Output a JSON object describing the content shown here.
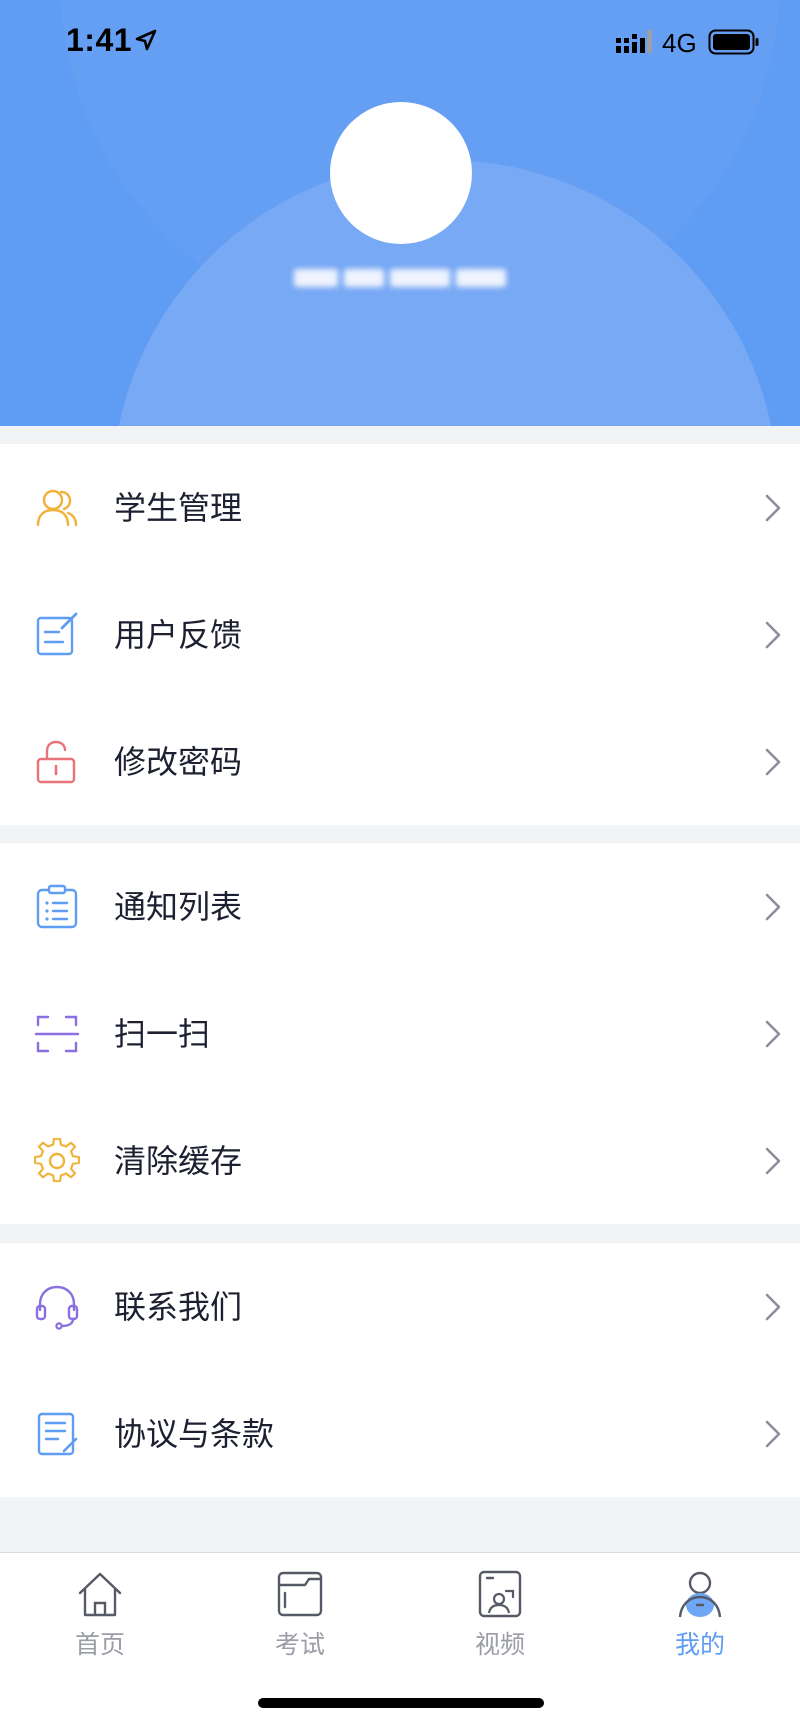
{
  "status_bar": {
    "time": "1:41",
    "network": "4G",
    "location_icon": "location-arrow-icon",
    "signal_icon": "signal-bars-icon",
    "battery_icon": "battery-icon"
  },
  "profile": {
    "avatar_icon": "avatar-circle",
    "username": ""
  },
  "menu_groups": [
    {
      "items": [
        {
          "label": "学生管理",
          "icon": "students-icon",
          "color": "#f0b23a"
        },
        {
          "label": "用户反馈",
          "icon": "feedback-edit-icon",
          "color": "#5f9cf3"
        },
        {
          "label": "修改密码",
          "icon": "unlock-icon",
          "color": "#e8737a"
        }
      ]
    },
    {
      "items": [
        {
          "label": "通知列表",
          "icon": "clipboard-list-icon",
          "color": "#5f9cf3"
        },
        {
          "label": "扫一扫",
          "icon": "scan-icon",
          "color": "#8a6fe0"
        },
        {
          "label": "清除缓存",
          "icon": "gear-icon",
          "color": "#f0b23a"
        }
      ]
    },
    {
      "items": [
        {
          "label": "联系我们",
          "icon": "headset-icon",
          "color": "#8a6fe0"
        },
        {
          "label": "协议与条款",
          "icon": "document-icon",
          "color": "#5f9cf3"
        }
      ]
    }
  ],
  "tabs": [
    {
      "label": "首页",
      "icon": "home-icon",
      "active": false
    },
    {
      "label": "考试",
      "icon": "folder-icon",
      "active": false
    },
    {
      "label": "视频",
      "icon": "video-icon",
      "active": false
    },
    {
      "label": "我的",
      "icon": "profile-icon",
      "active": true
    }
  ],
  "colors": {
    "accent": "#5f9cf3",
    "tab_inactive": "#9a9da6",
    "text": "#1d2030",
    "chevron": "#8a8f9b"
  }
}
